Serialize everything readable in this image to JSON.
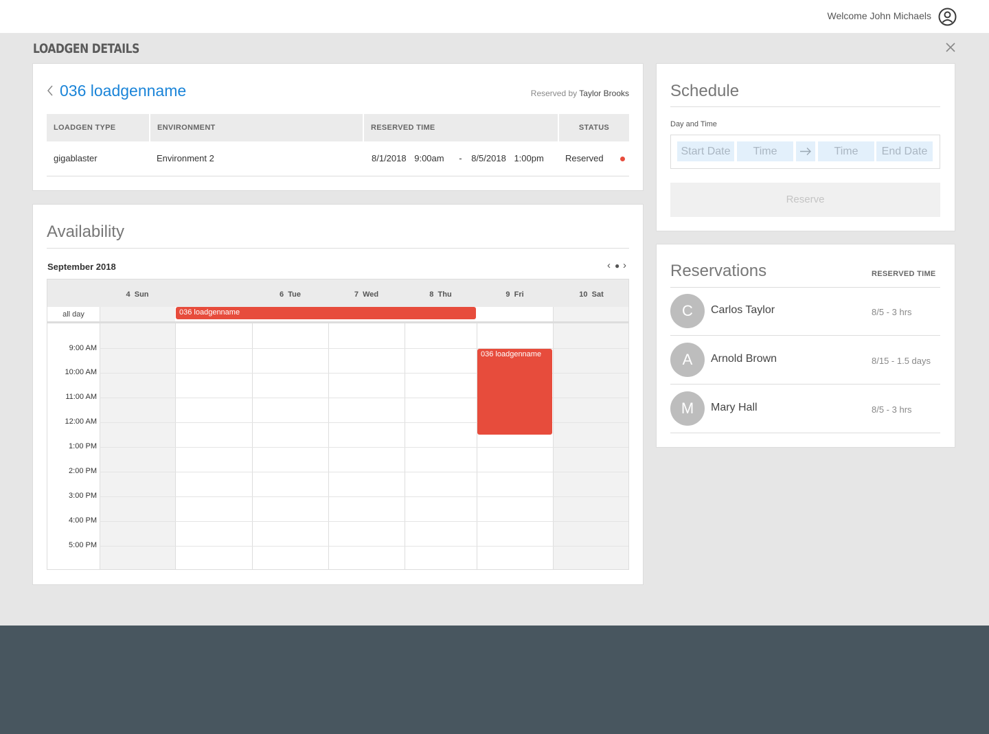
{
  "header": {
    "welcome_text": "Welcome John Michaels",
    "user_icon": "user-circle-icon"
  },
  "page": {
    "title": "LOADGEN DETAILS",
    "close_icon": "close-icon"
  },
  "details": {
    "name": "036 loadgenname",
    "reserved_by_label": "Reserved by",
    "reserved_by_name": "Taylor Brooks",
    "columns": [
      "LOADGEN TYPE",
      "ENVIRONMENT",
      "RESERVED TIME",
      "STATUS"
    ],
    "row": {
      "type": "gigablaster",
      "environment": "Environment 2",
      "start_date": "8/1/2018",
      "start_time": "9:00am",
      "separator": "-",
      "end_date": "8/5/2018",
      "end_time": "1:00pm",
      "status": "Reserved",
      "status_color": "#e74c3c"
    }
  },
  "availability": {
    "title": "Availability",
    "month": "September 2018",
    "days": [
      {
        "num": "4",
        "name": "Sun"
      },
      {
        "num": "",
        "name": ""
      },
      {
        "num": "6",
        "name": "Tue"
      },
      {
        "num": "7",
        "name": "Wed"
      },
      {
        "num": "8",
        "name": "Thu"
      },
      {
        "num": "9",
        "name": "Fri"
      },
      {
        "num": "10",
        "name": "Sat"
      }
    ],
    "all_day_label": "all day",
    "times": [
      "9:00 AM",
      "10:00 AM",
      "11:00 AM",
      "12:00 AM",
      "1:00 PM",
      "2:00 PM",
      "3:00 PM",
      "4:00 PM",
      "5:00 PM"
    ],
    "allday_event": "036 loadgenname",
    "timed_event": "036 loadgenname",
    "event_color": "#e74c3c"
  },
  "schedule": {
    "title": "Schedule",
    "day_time_label": "Day and Time",
    "start_date_placeholder": "Start Date",
    "start_time_placeholder": "Time",
    "end_time_placeholder": "Time",
    "end_date_placeholder": "End Date",
    "reserve_label": "Reserve"
  },
  "reservations": {
    "title": "Reservations",
    "col_label": "RESERVED TIME",
    "items": [
      {
        "initial": "C",
        "name": "Carlos Taylor",
        "time": "8/5 - 3 hrs"
      },
      {
        "initial": "A",
        "name": "Arnold Brown",
        "time": "8/15 - 1.5 days"
      },
      {
        "initial": "M",
        "name": "Mary Hall",
        "time": "8/5 - 3 hrs"
      }
    ]
  },
  "colors": {
    "accent": "#1a84d8",
    "event": "#e74c3c",
    "footer": "#48565f"
  }
}
